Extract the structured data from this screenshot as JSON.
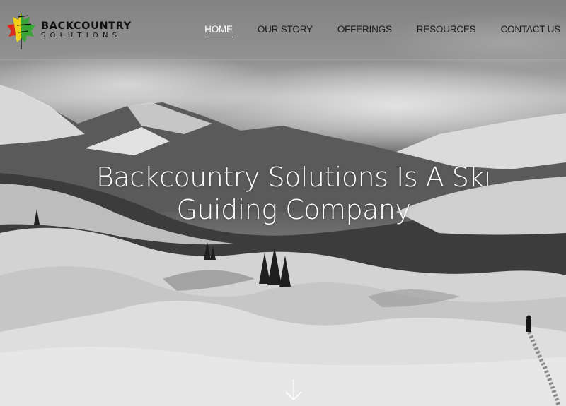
{
  "brand": {
    "line1": "BACKCOUNTRY",
    "line2": "SOLUTIONS"
  },
  "nav": {
    "items": [
      {
        "label": "HOME",
        "active": true
      },
      {
        "label": "OUR STORY",
        "active": false
      },
      {
        "label": "OFFERINGS",
        "active": false
      },
      {
        "label": "RESOURCES",
        "active": false
      },
      {
        "label": "CONTACT US",
        "active": false
      }
    ]
  },
  "hero": {
    "title": "Backcountry Solutions Is A Ski Guiding Company",
    "scroll_icon": "arrow-down-icon"
  },
  "colors": {
    "nav_text": "#1c1c1c",
    "nav_active": "#ffffff",
    "hero_text": "#ffffff",
    "logo_red": "#d72a1f",
    "logo_yellow": "#f2d21b",
    "logo_green": "#3aa335"
  }
}
